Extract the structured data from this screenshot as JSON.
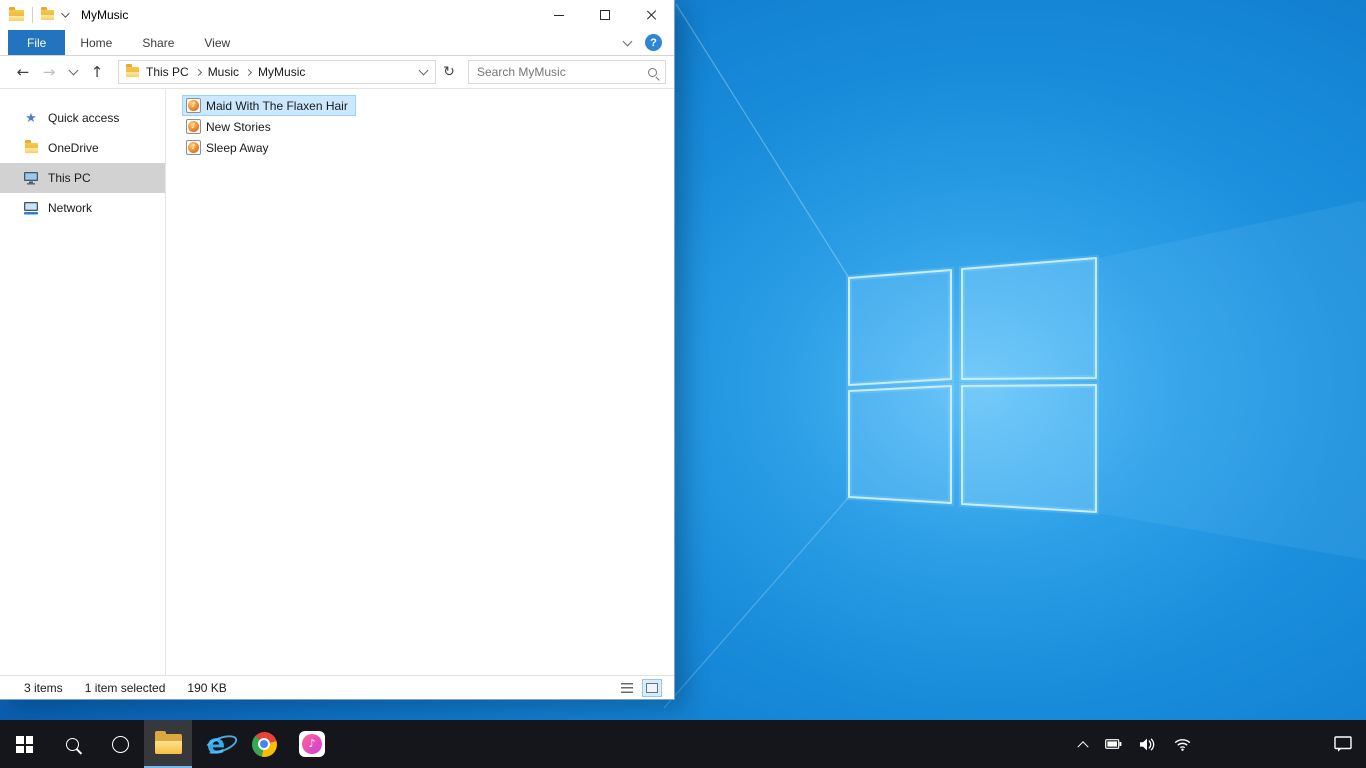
{
  "explorer": {
    "title": "MyMusic",
    "ribbon": {
      "tabs": [
        {
          "label": "File"
        },
        {
          "label": "Home"
        },
        {
          "label": "Share"
        },
        {
          "label": "View"
        }
      ]
    },
    "nav": {
      "breadcrumb": [
        {
          "label": "This PC"
        },
        {
          "label": "Music"
        },
        {
          "label": "MyMusic"
        }
      ],
      "search_placeholder": "Search MyMusic"
    },
    "sidebar": {
      "items": [
        {
          "label": "Quick access"
        },
        {
          "label": "OneDrive"
        },
        {
          "label": "This PC",
          "selected": true
        },
        {
          "label": "Network"
        }
      ]
    },
    "files": [
      {
        "name": "Maid With The Flaxen Hair",
        "selected": true
      },
      {
        "name": "New Stories",
        "selected": false
      },
      {
        "name": "Sleep Away",
        "selected": false
      }
    ],
    "status": {
      "items_count": "3 items",
      "selection": "1 item selected",
      "size": "190 KB"
    }
  },
  "icons": {
    "back_arrow": "←",
    "forward_arrow": "→",
    "up_arrow": "↑",
    "refresh": "↻",
    "star": "★",
    "note": "♪",
    "help": "?",
    "ie": "e"
  },
  "colors": {
    "accent": "#0078d7",
    "file_tab_blue": "#2274be",
    "selection_fill": "#cce8ff",
    "selection_border": "#99d1ff",
    "taskbar": "#14161b"
  }
}
